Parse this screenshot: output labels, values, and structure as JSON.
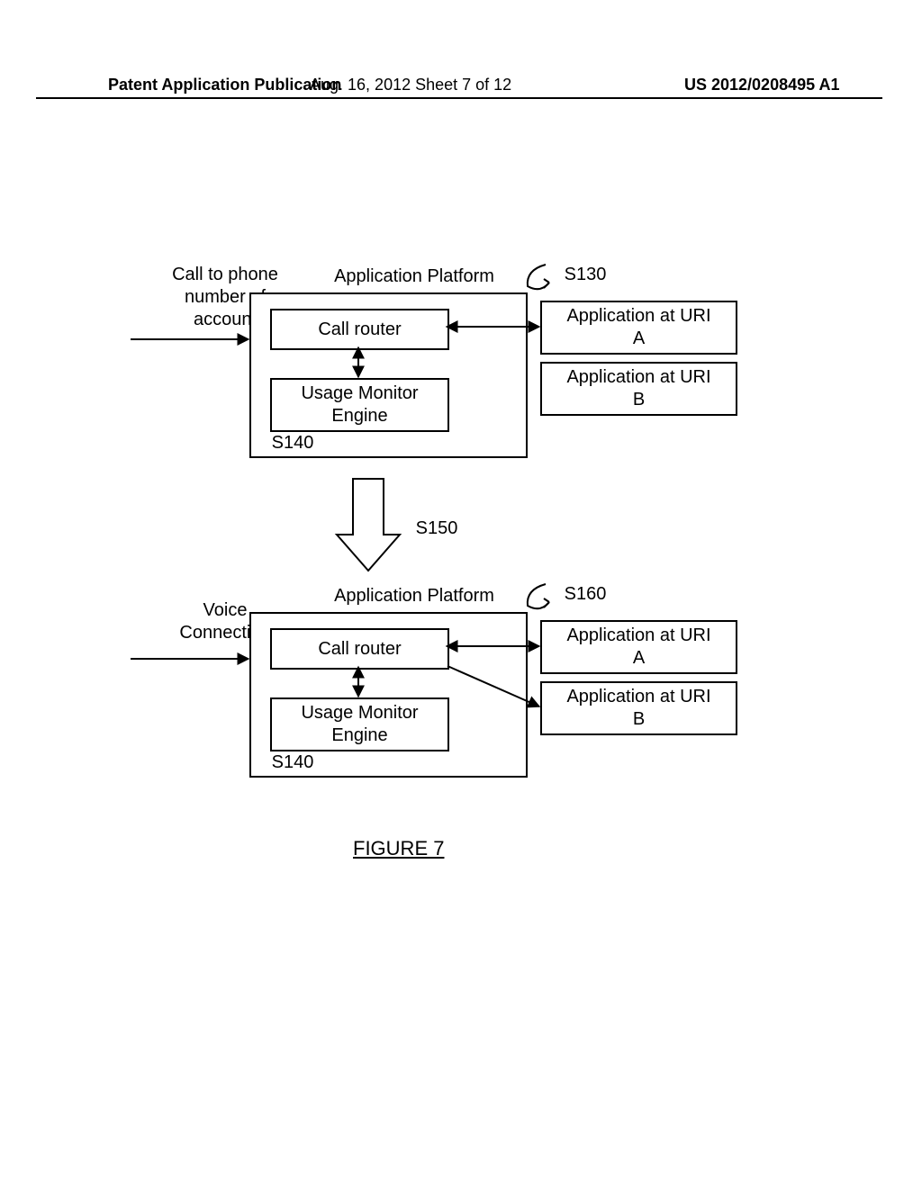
{
  "header": {
    "left": "Patent Application Publication",
    "center": "Aug. 16, 2012  Sheet 7 of 12",
    "right": "US 2012/0208495 A1"
  },
  "top": {
    "incoming_label": "Call to phone\nnumber of\naccount",
    "platform_title": "Application Platform",
    "call_router": "Call router",
    "usage_monitor": "Usage Monitor\nEngine",
    "s140": "S140",
    "s130": "S130",
    "app_a": "Application at URI\nA",
    "app_b": "Application at URI\nB"
  },
  "transition": {
    "s150": "S150"
  },
  "bottom": {
    "incoming_label": "Voice\nConnection",
    "platform_title": "Application Platform",
    "call_router": "Call router",
    "usage_monitor": "Usage Monitor\nEngine",
    "s140": "S140",
    "s160": "S160",
    "app_a": "Application at URI\nA",
    "app_b": "Application at URI\nB"
  },
  "figure_label": "FIGURE 7"
}
